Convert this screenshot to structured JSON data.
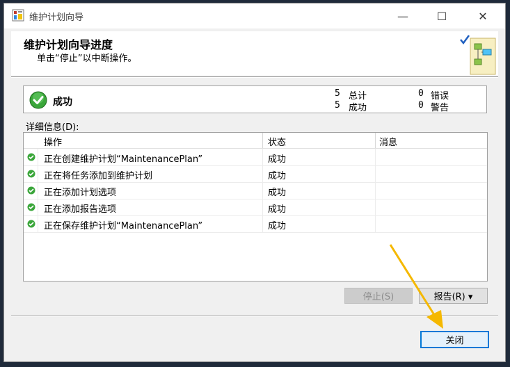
{
  "window": {
    "title": "维护计划向导",
    "minimize_glyph": "—",
    "maximize_glyph": "☐",
    "close_glyph": "✕"
  },
  "header": {
    "title": "维护计划向导进度",
    "subtitle": "单击“停止”以中断操作。"
  },
  "status": {
    "label": "成功",
    "total_count": "5",
    "total_label": "总计",
    "success_count": "5",
    "success_label": "成功",
    "error_count": "0",
    "error_label": "错误",
    "warning_count": "0",
    "warning_label": "警告"
  },
  "details": {
    "label": "详细信息(D):",
    "columns": [
      "操作",
      "状态",
      "消息"
    ],
    "rows": [
      {
        "operation": "正在创建维护计划“MaintenancePlan”",
        "status": "成功",
        "message": ""
      },
      {
        "operation": "正在将任务添加到维护计划",
        "status": "成功",
        "message": ""
      },
      {
        "operation": "正在添加计划选项",
        "status": "成功",
        "message": ""
      },
      {
        "operation": "正在添加报告选项",
        "status": "成功",
        "message": ""
      },
      {
        "operation": "正在保存维护计划“MaintenancePlan”",
        "status": "成功",
        "message": ""
      }
    ]
  },
  "buttons": {
    "stop_label": "停止(S)",
    "report_label": "报告(R) ▾",
    "close_label": "关闭"
  },
  "colors": {
    "accent": "#0078d7",
    "success": "#2e9b2e",
    "annotation_arrow": "#f5b800"
  },
  "icons": {
    "status": "success-check-icon",
    "row": "success-dot-icon",
    "app": "maintenance-plan-icon"
  }
}
